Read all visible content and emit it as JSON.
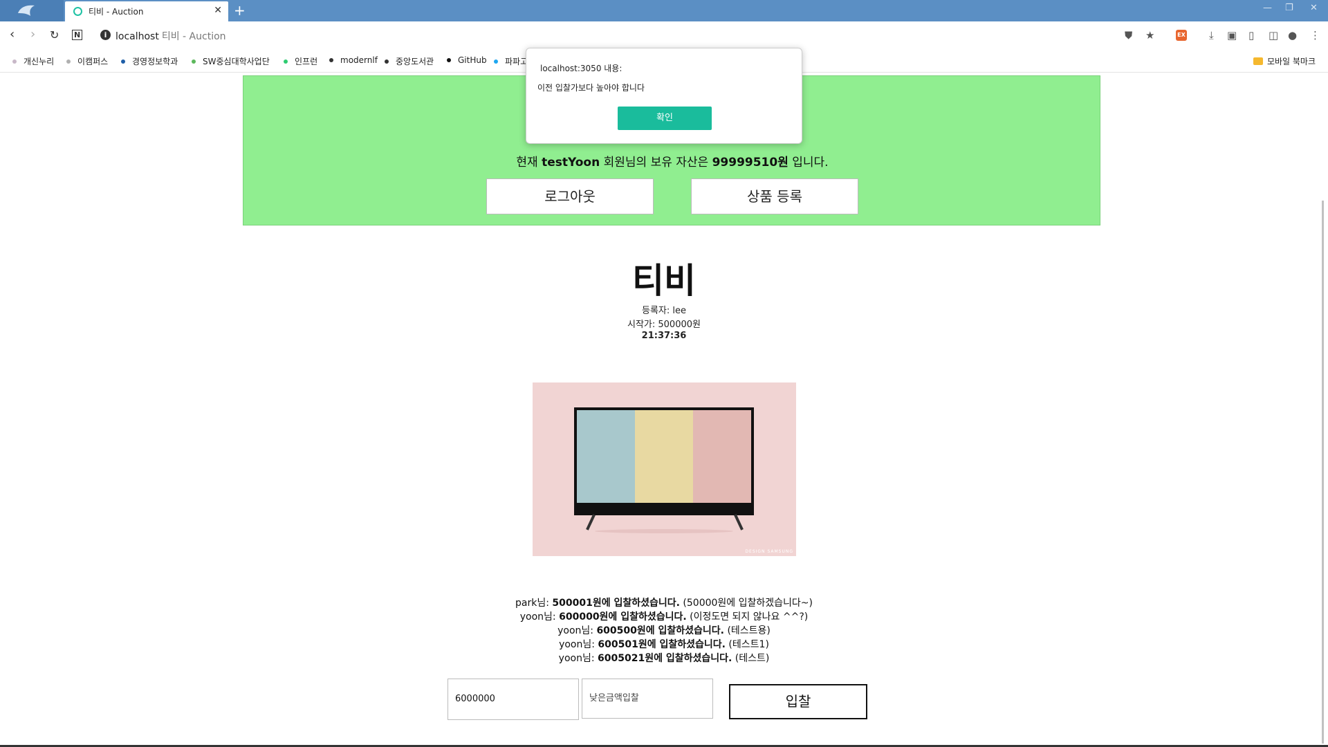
{
  "browser": {
    "tab_title": "티비 - Auction",
    "new_tab": "+",
    "tab_close": "✕",
    "url_host": "localhost",
    "url_title": "티비 - Auction",
    "window_controls": [
      "—",
      "❐",
      "✕"
    ]
  },
  "bookmarks": {
    "items": [
      {
        "label": "개신누리",
        "color": "#c8b8c8"
      },
      {
        "label": "이캠퍼스",
        "color": "#b0b0b0"
      },
      {
        "label": "경영정보학과",
        "color": "#1f5fa8"
      },
      {
        "label": "SW중심대학사업단",
        "color": "#5cb85c"
      },
      {
        "label": "인프런",
        "color": "#2ecc71"
      },
      {
        "label": "modernlf",
        "color": "#333333"
      },
      {
        "label": "중앙도서관",
        "color": "#333333"
      },
      {
        "label": "GitHub",
        "color": "#111111"
      },
      {
        "label": "파파고",
        "color": "#1ea7f0"
      }
    ],
    "mobile": "모바일 북마크"
  },
  "header": {
    "asset_prefix": "현재 ",
    "username": "testYoon",
    "asset_middle": " 회원님의 보유 자산은 ",
    "asset_amount": "99999510원",
    "asset_suffix": " 입니다.",
    "logout_label": "로그아웃",
    "register_label": "상품 등록"
  },
  "product": {
    "title": "티비",
    "owner": "등록자: lee",
    "start_price": "시작가: 500000원",
    "timer": "21:37:36",
    "image_watermark": "DESIGN SAMSUNG"
  },
  "bids": [
    {
      "user": "park님: ",
      "amount": "500001원에 입찰하셨습니다.",
      "msg": " (50000원에 입찰하겠습니다~)"
    },
    {
      "user": "yoon님: ",
      "amount": "600000원에 입찰하셨습니다.",
      "msg": " (이정도면 되지 않나요 ^^?)"
    },
    {
      "user": "yoon님: ",
      "amount": "600500원에 입찰하셨습니다.",
      "msg": " (테스트용)"
    },
    {
      "user": "yoon님: ",
      "amount": "600501원에 입찰하셨습니다.",
      "msg": " (테스트1)"
    },
    {
      "user": "yoon님: ",
      "amount": "6005021원에 입찰하셨습니다.",
      "msg": " (테스트)"
    }
  ],
  "bid_form": {
    "amount_value": "6000000",
    "message_value": "낮은금액입찰",
    "submit_label": "입찰"
  },
  "dialog": {
    "origin": "localhost:3050 내용:",
    "message": "이전 입찰가보다 높아야 합니다",
    "ok_label": "확인"
  },
  "colors": {
    "header_bg": "#90ee90",
    "dialog_button": "#1abc9c",
    "tab_bar": "#5b8fc4",
    "tv_background": "#f1d4d3",
    "tv_stripes": [
      "#a8c8cc",
      "#e8d9a2",
      "#e2b8b3"
    ]
  }
}
